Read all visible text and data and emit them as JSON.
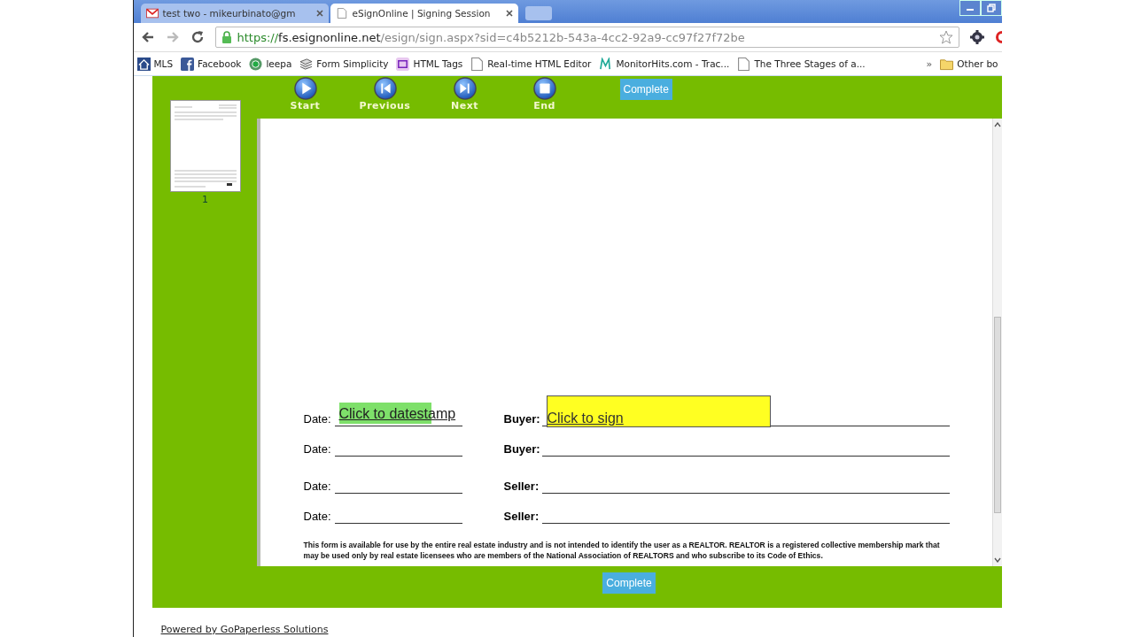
{
  "tabs": [
    {
      "title": "test two - mikeurbinato@gm",
      "selected": false
    },
    {
      "title": "eSignOnline | Signing Session",
      "selected": true
    }
  ],
  "address": {
    "scheme": "https://",
    "host": "fs.esignonline.net",
    "path": "/esign/sign.aspx?sid=c4b5212b-543a-4cc2-92a9-cc97f27f72be"
  },
  "bookmarks": [
    {
      "label": "MLS"
    },
    {
      "label": "Facebook"
    },
    {
      "label": "leepa"
    },
    {
      "label": "Form Simplicity"
    },
    {
      "label": "HTML Tags"
    },
    {
      "label": "Real-time HTML Editor"
    },
    {
      "label": "MonitorHits.com - Trac..."
    },
    {
      "label": "The Three Stages of a..."
    }
  ],
  "bookmarks_more": "»",
  "other_bookmarks": "Other bo",
  "thumbnails": [
    {
      "label": "1"
    }
  ],
  "nav_buttons": [
    {
      "label": "Start",
      "kind": "start"
    },
    {
      "label": "Previous",
      "kind": "previous"
    },
    {
      "label": "Next",
      "kind": "next"
    },
    {
      "label": "End",
      "kind": "end"
    }
  ],
  "complete_top": "Complete",
  "signature_rows": [
    {
      "date_label": "Date:",
      "date_field": "Click to datestamp",
      "party_label": "Buyer:",
      "sign_field": "Click to sign"
    },
    {
      "date_label": "Date:",
      "party_label": "Buyer:"
    },
    {
      "date_label": "Date:",
      "party_label": "Seller:"
    },
    {
      "date_label": "Date:",
      "party_label": "Seller:"
    }
  ],
  "notice": "This form is available for use by the entire real estate industry and is not intended to identify the user as a REALTOR. REALTOR is a registered collective membership mark that may be used only by real estate licensees who are members of the National Association of REALTORS and who subscribe to its Code of Ethics.",
  "complete_bottom": "Complete",
  "powered_by": "Powered by GoPaperless Solutions"
}
